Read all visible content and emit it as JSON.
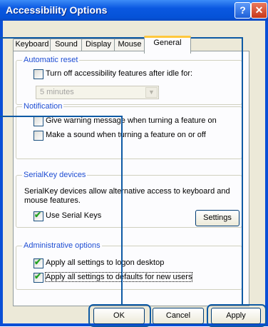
{
  "window": {
    "title": "Accessibility Options",
    "help_glyph": "?",
    "close_glyph": "✕"
  },
  "tabs": [
    "Keyboard",
    "Sound",
    "Display",
    "Mouse",
    "General"
  ],
  "automatic_reset": {
    "label": "Automatic reset",
    "checkbox_label": "Turn off accessibility features after idle for:",
    "checked": false,
    "dropdown_value": "5 minutes"
  },
  "notification": {
    "label": "Notification",
    "option1": "Give warning message when turning a feature on",
    "option2": "Make a sound when turning a feature on or off"
  },
  "serialkey": {
    "label": "SerialKey devices",
    "description": "SerialKey devices allow alternative access to keyboard and mouse features.",
    "checkbox_label": "Use Serial Keys",
    "checked": true,
    "settings_button": "Settings"
  },
  "admin": {
    "label": "Administrative options",
    "option1": "Apply all settings to logon desktop",
    "option2": "Apply all settings to defaults for new users",
    "option1_checked": true,
    "option2_checked": true
  },
  "buttons": {
    "ok": "OK",
    "cancel": "Cancel",
    "apply": "Apply"
  }
}
